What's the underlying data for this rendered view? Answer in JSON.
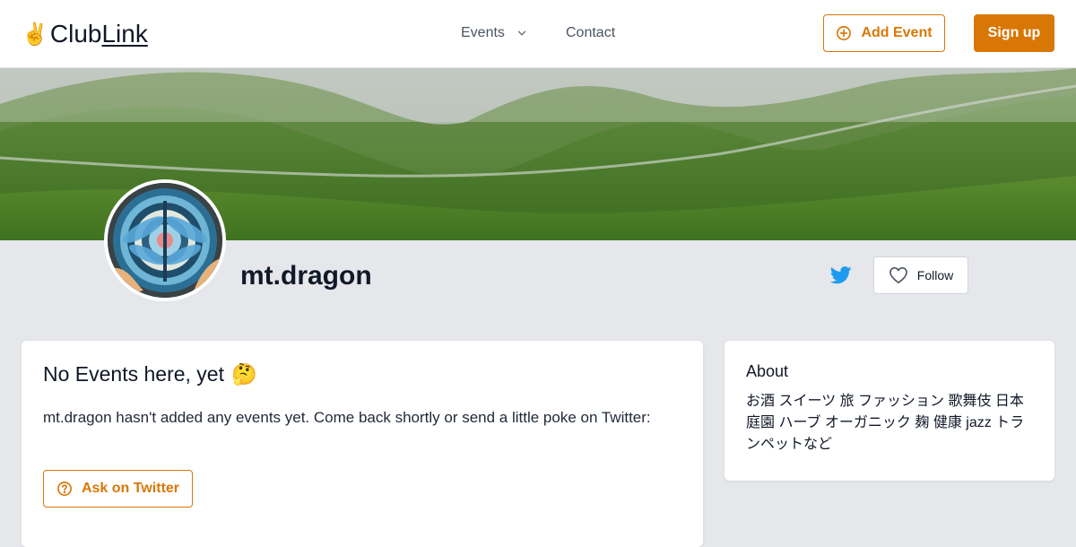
{
  "header": {
    "logo_hand": "✌️",
    "logo_club": "Club",
    "logo_link": "Link",
    "nav_events": "Events",
    "nav_contact": "Contact",
    "add_event_label": "Add Event",
    "signup_label": "Sign up"
  },
  "profile": {
    "name": "mt.dragon",
    "follow_label": "Follow"
  },
  "events": {
    "title": "No Events here, yet",
    "title_emoji": "🤔",
    "message": "mt.dragon hasn't added any events yet. Come back shortly or send a little poke on Twitter:",
    "ask_label": "Ask on Twitter"
  },
  "about": {
    "title": "About",
    "text": "お酒 スイーツ 旅 ファッション 歌舞伎 日本庭園 ハーブ オーガニック 麹 健康 jazz トランペットなど"
  },
  "colors": {
    "accent": "#d97706",
    "twitter": "#1d9bf0",
    "page_bg": "#e5e7eb"
  }
}
